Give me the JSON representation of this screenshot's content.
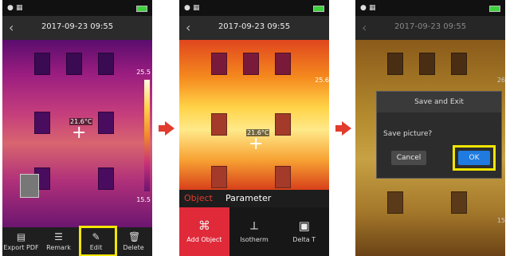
{
  "colors": {
    "highlight": "#f2e600",
    "arrow": "#e23c2e",
    "active_tab": "#e23c2e",
    "ok_button": "#1f7be0"
  },
  "screen1": {
    "timestamp": "2017-09-23 09:55",
    "scale_max": "25.5",
    "scale_min": "15.5",
    "spot_temp": "21.6°C",
    "toolbar": [
      {
        "label": "Export PDF",
        "icon": "pdf-icon"
      },
      {
        "label": "Remark",
        "icon": "remark-icon"
      },
      {
        "label": "Edit",
        "icon": "pencil-icon"
      },
      {
        "label": "Delete",
        "icon": "trash-icon"
      }
    ]
  },
  "screen2": {
    "timestamp": "2017-09-23 09:55",
    "scale_max": "25.6",
    "spot_temp": "21.6°C",
    "tabs": [
      "Object",
      "Parameter"
    ],
    "tools": [
      {
        "label": "Add Object",
        "icon": "add-object-icon"
      },
      {
        "label": "Isotherm",
        "icon": "isotherm-icon"
      },
      {
        "label": "Delta T",
        "icon": "delta-t-icon"
      }
    ]
  },
  "screen3": {
    "timestamp": "2017-09-23 09:55",
    "scale_max": "26",
    "scale_min": "15",
    "dialog": {
      "title": "Save and Exit",
      "message": "Save picture?",
      "cancel": "Cancel",
      "ok": "OK"
    }
  }
}
